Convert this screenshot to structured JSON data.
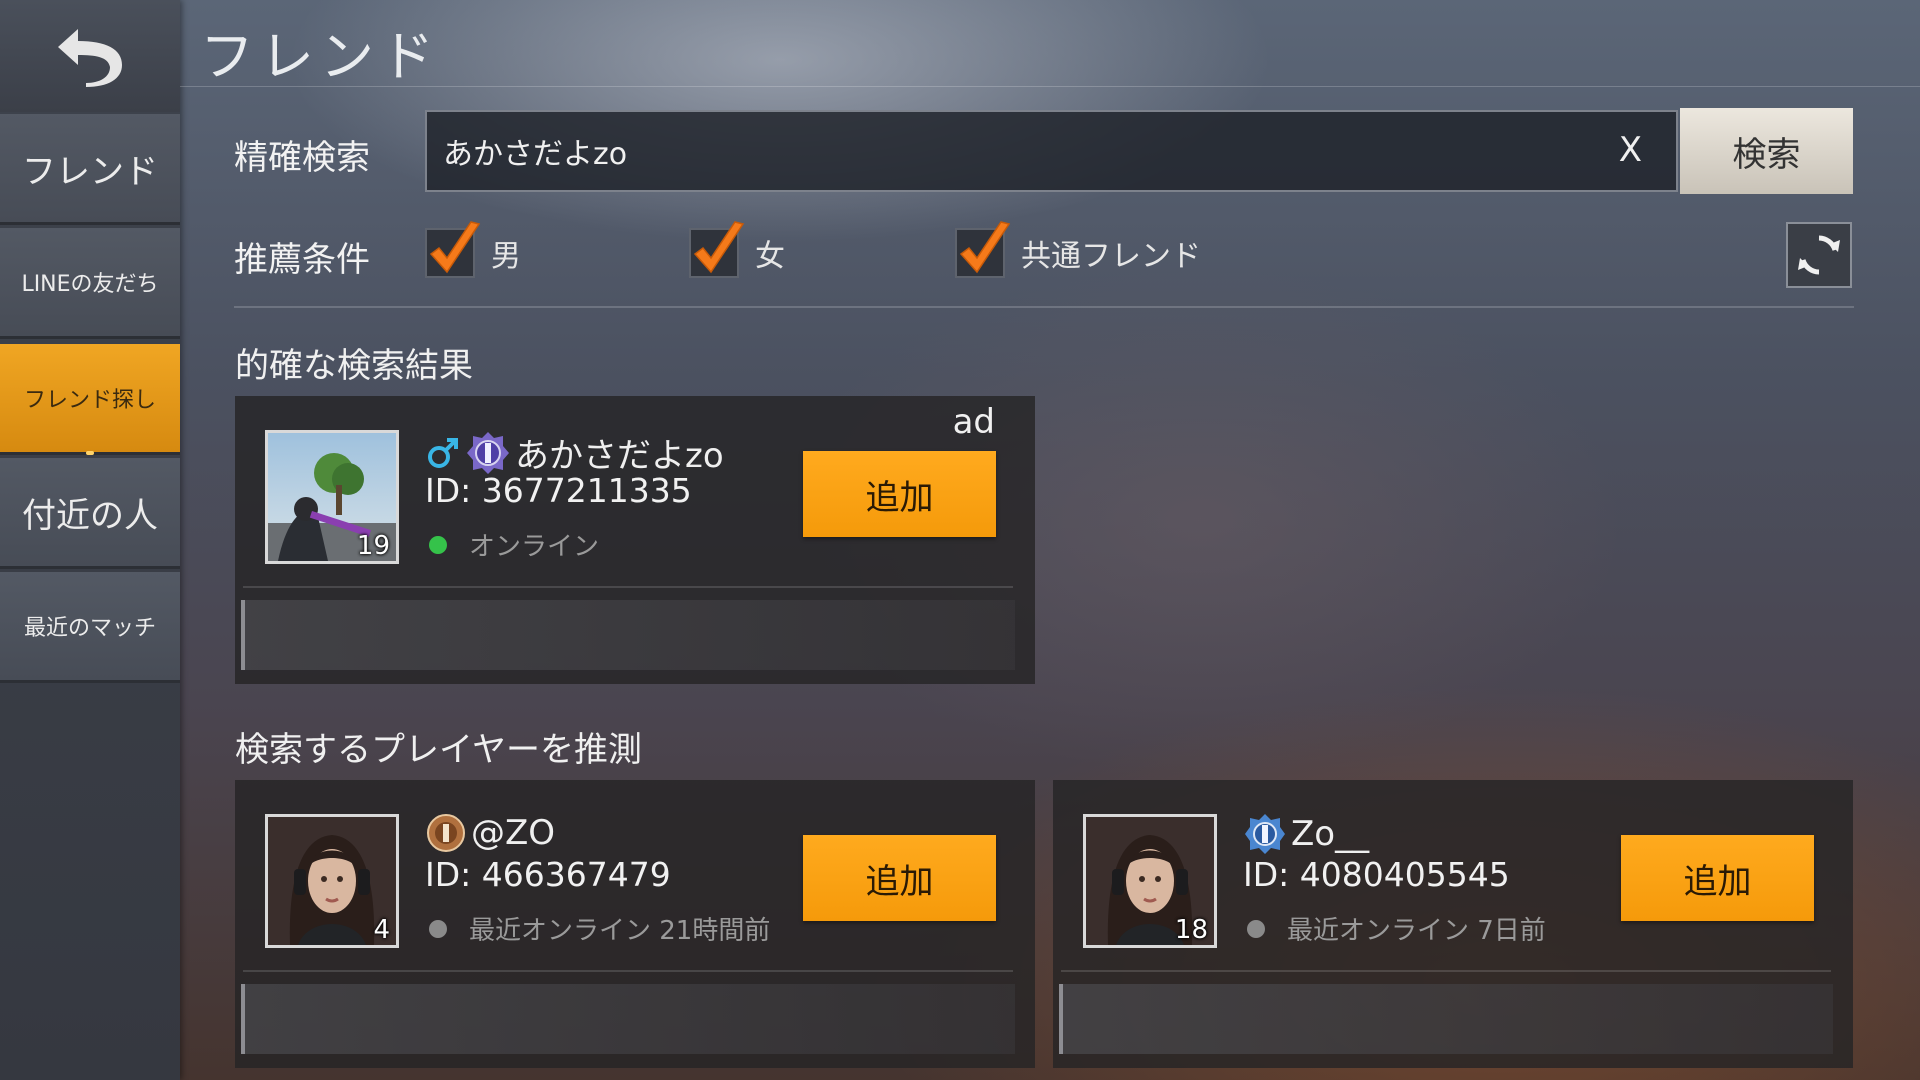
{
  "title": "フレンド",
  "sidebar": {
    "items": [
      {
        "label": "フレンド",
        "active": false
      },
      {
        "label": "LINEの友だち",
        "active": false
      },
      {
        "label": "フレンド探し",
        "active": true
      },
      {
        "label": "付近の人",
        "active": false
      },
      {
        "label": "最近のマッチ",
        "active": false
      }
    ]
  },
  "search": {
    "label": "精確検索",
    "value": "あかさだよzo",
    "clear": "X",
    "button": "検索"
  },
  "filters": {
    "label": "推薦条件",
    "options": [
      {
        "label": "男",
        "checked": true
      },
      {
        "label": "女",
        "checked": true
      },
      {
        "label": "共通フレンド",
        "checked": true
      }
    ]
  },
  "exact": {
    "title": "的確な検索結果",
    "players": [
      {
        "name": "あかさだよzo",
        "id": "ID: 3677211335",
        "status": "オンライン",
        "level": "19",
        "tag": "ad",
        "add": "追加",
        "online": true
      }
    ]
  },
  "guess": {
    "title": "検索するプレイヤーを推測",
    "players": [
      {
        "name": "@ZO",
        "id": "ID: 466367479",
        "status": "最近オンライン 21時間前",
        "level": "4",
        "add": "追加",
        "online": false
      },
      {
        "name": "Zo__",
        "id": "ID: 4080405545",
        "status": "最近オンライン 7日前",
        "level": "18",
        "add": "追加",
        "online": false
      }
    ]
  },
  "colors": {
    "accent": "#f5a016",
    "online": "#35c24a",
    "offline": "#8a8a8a",
    "check": "#f57a1a"
  }
}
